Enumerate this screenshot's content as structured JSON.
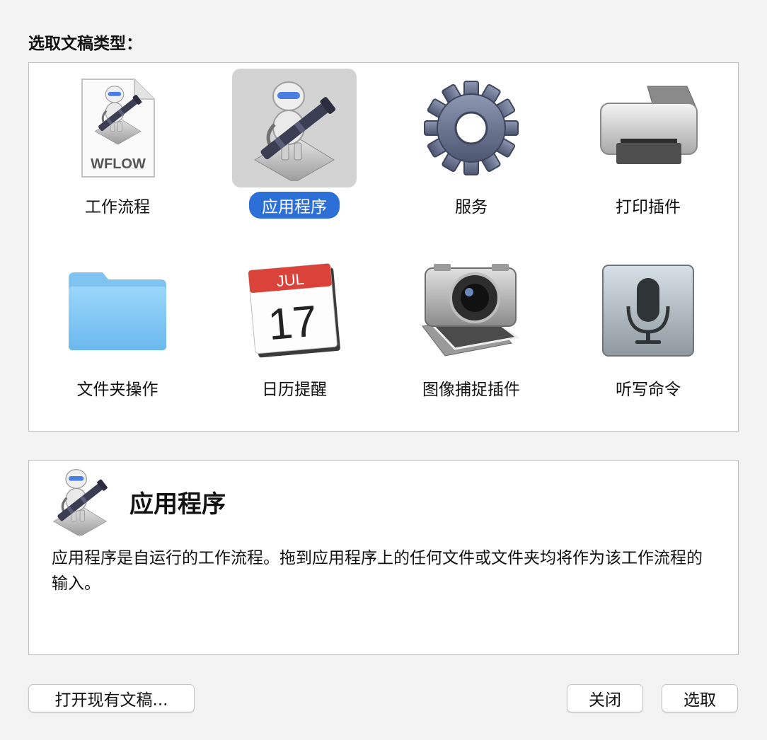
{
  "prompt": "选取文稿类型：",
  "types": [
    {
      "label": "工作流程",
      "icon": "workflow-document-icon",
      "badge": "WFLOW"
    },
    {
      "label": "应用程序",
      "icon": "automator-robot-icon"
    },
    {
      "label": "服务",
      "icon": "gear-icon"
    },
    {
      "label": "打印插件",
      "icon": "printer-icon"
    },
    {
      "label": "文件夹操作",
      "icon": "folder-icon"
    },
    {
      "label": "日历提醒",
      "icon": "calendar-icon",
      "month": "JUL",
      "day": "17"
    },
    {
      "label": "图像捕捉插件",
      "icon": "image-capture-icon"
    },
    {
      "label": "听写命令",
      "icon": "microphone-icon"
    }
  ],
  "selected_index": 1,
  "description": {
    "title": "应用程序",
    "body": "应用程序是自运行的工作流程。拖到应用程序上的任何文件或文件夹均将作为该工作流程的输入。"
  },
  "buttons": {
    "open": "打开现有文稿...",
    "close": "关闭",
    "choose": "选取"
  },
  "colors": {
    "selection": "#2b6fd7",
    "calendar_red": "#d9433a",
    "folder_blue": "#8fcdf5"
  }
}
